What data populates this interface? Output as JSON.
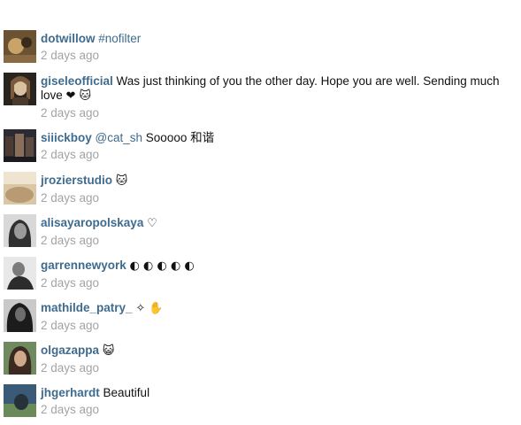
{
  "comments": [
    {
      "username": "dotwillow",
      "pre_text": "",
      "mention": "",
      "hashtag": "#nofilter",
      "text": "",
      "emoji": "",
      "time": "2 days ago",
      "avatar_colors": [
        "#6b5232",
        "#c8a46a",
        "#3a2a1a"
      ]
    },
    {
      "username": "giseleofficial",
      "pre_text": "",
      "mention": "",
      "hashtag": "",
      "text": "Was just thinking of you the other day. Hope you are well. Sending much love",
      "emoji": "❤ 🐱",
      "time": "2 days ago",
      "avatar_colors": [
        "#2a241f",
        "#d9c1a0",
        "#7a5a3c"
      ]
    },
    {
      "username": "siiickboy",
      "pre_text": "",
      "mention": "@cat_sh",
      "hashtag": "",
      "text": "Sooooo 和谐",
      "emoji": "",
      "time": "2 days ago",
      "avatar_colors": [
        "#2b2b34",
        "#8a6e5a",
        "#4c3b33"
      ]
    },
    {
      "username": "jrozierstudio",
      "pre_text": "",
      "mention": "",
      "hashtag": "",
      "text": "",
      "emoji": "🐱",
      "time": "2 days ago",
      "avatar_colors": [
        "#d9c7a5",
        "#b89a73",
        "#efe4cf"
      ]
    },
    {
      "username": "alisayaropolskaya",
      "pre_text": "",
      "mention": "",
      "hashtag": "",
      "text": "",
      "emoji": "♡",
      "time": "2 days ago",
      "avatar_colors": [
        "#303030",
        "#9a9a9a",
        "#d8d8d8"
      ]
    },
    {
      "username": "garrennewyork",
      "pre_text": "",
      "mention": "",
      "hashtag": "",
      "text": "",
      "emoji": "◐ ◐ ◐ ◐ ◐",
      "time": "2 days ago",
      "avatar_colors": [
        "#e8e8e8",
        "#7c7c7c",
        "#2c2c2c"
      ]
    },
    {
      "username": "mathilde_patry_",
      "pre_text": "",
      "mention": "",
      "hashtag": "",
      "text": "",
      "emoji": "✧ ✋",
      "time": "2 days ago",
      "avatar_colors": [
        "#1c1c1c",
        "#6d6d6d",
        "#c9c9c9"
      ]
    },
    {
      "username": "olgazappa",
      "pre_text": "",
      "mention": "",
      "hashtag": "",
      "text": "",
      "emoji": "😺",
      "time": "2 days ago",
      "avatar_colors": [
        "#6e8a5e",
        "#3b2a22",
        "#cfa98a"
      ]
    },
    {
      "username": "jhgerhardt",
      "pre_text": "",
      "mention": "",
      "hashtag": "",
      "text": "Beautiful",
      "emoji": "",
      "time": "2 days ago",
      "avatar_colors": [
        "#3a5a78",
        "#6a8a5a",
        "#27313a"
      ]
    }
  ]
}
